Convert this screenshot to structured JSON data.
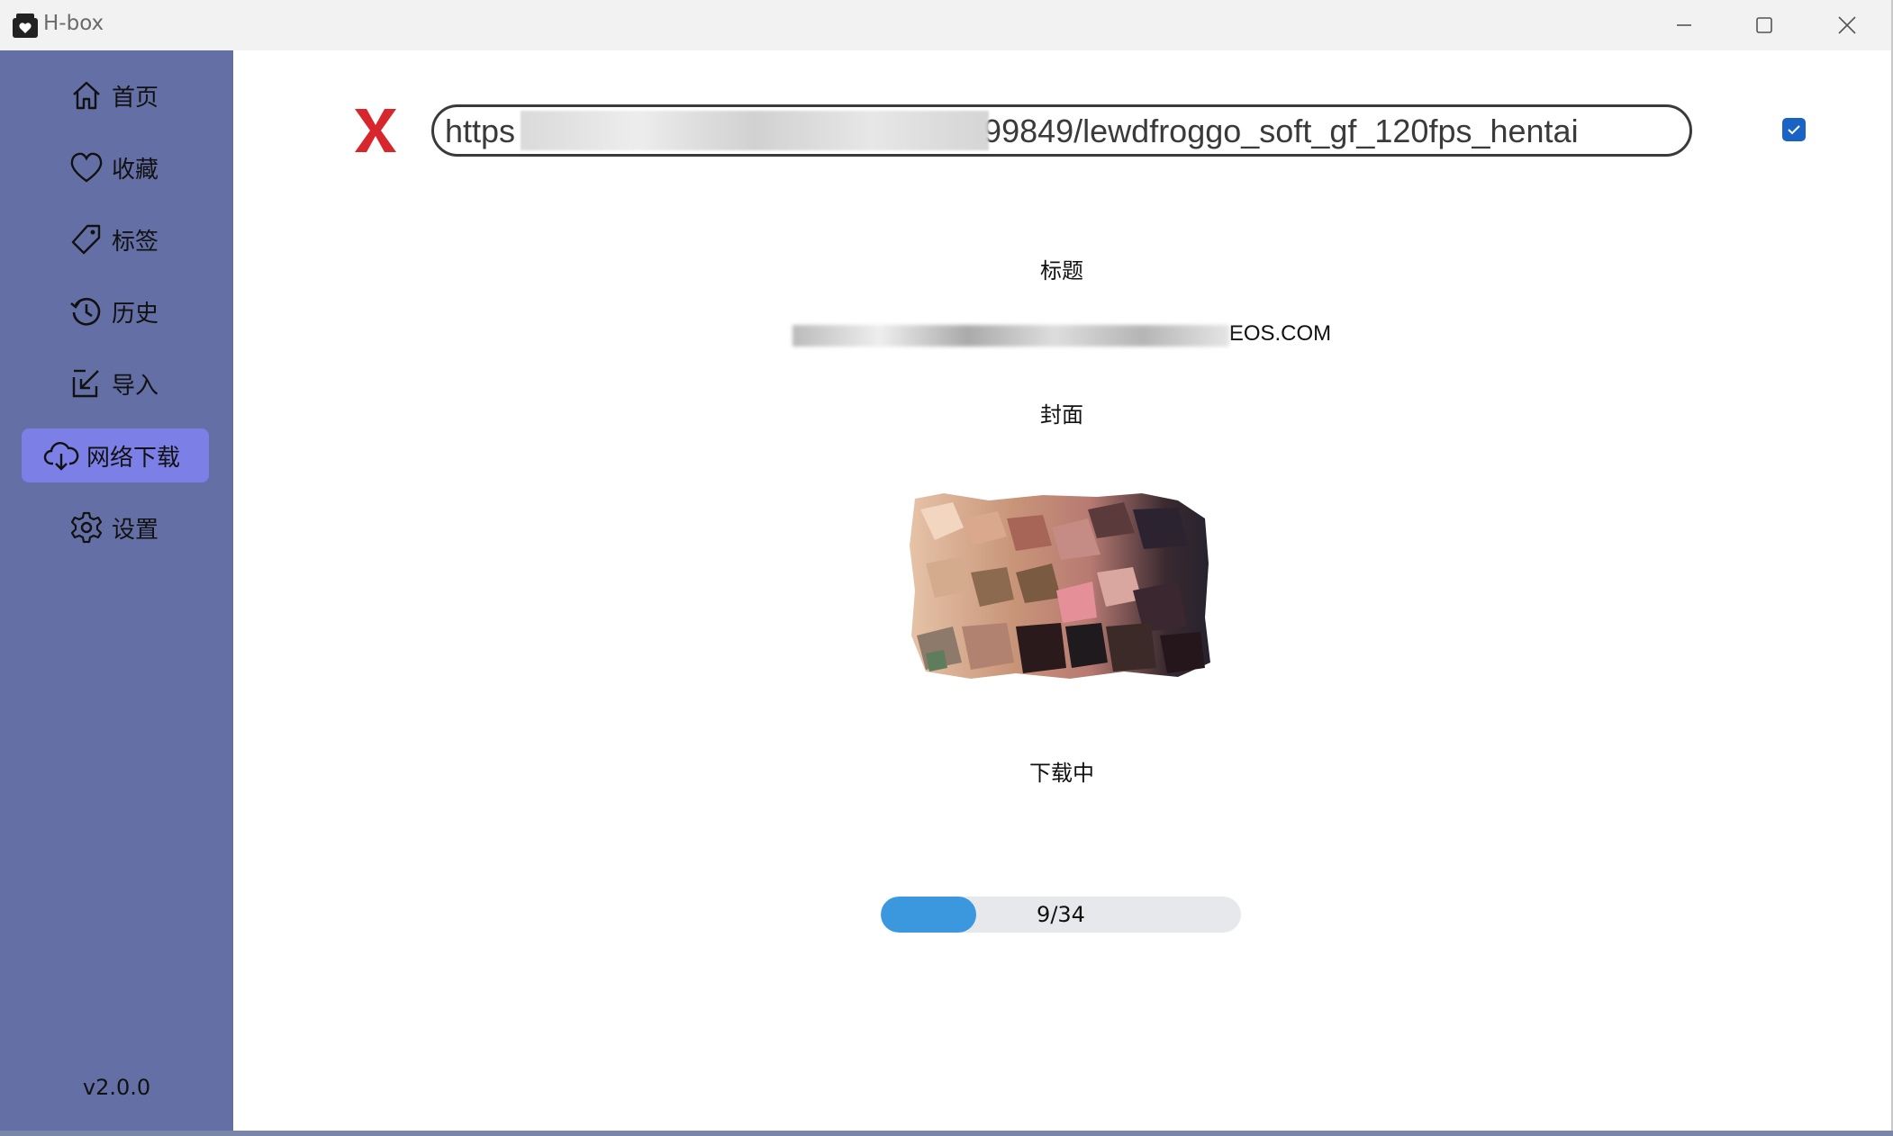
{
  "window": {
    "title": "H-box"
  },
  "sidebar": {
    "items": [
      {
        "label": "首页",
        "icon": "home-icon"
      },
      {
        "label": "收藏",
        "icon": "heart-icon"
      },
      {
        "label": "标签",
        "icon": "tag-icon"
      },
      {
        "label": "历史",
        "icon": "history-icon"
      },
      {
        "label": "导入",
        "icon": "import-icon"
      },
      {
        "label": "网络下载",
        "icon": "cloud-download-icon",
        "active": true
      },
      {
        "label": "设置",
        "icon": "gear-icon"
      }
    ],
    "version": "v2.0.0"
  },
  "download": {
    "url_prefix": "https",
    "url_suffix": "99849/lewdfroggo_soft_gf_120fps_hentai",
    "checkbox_checked": true,
    "title_label": "标题",
    "title_value_suffix": "EOS.COM",
    "cover_label": "封面",
    "status": "下载中",
    "progress": {
      "current": 9,
      "total": 34,
      "text": "9/34"
    }
  },
  "colors": {
    "sidebar": "#6470a5",
    "active_item": "#7b7fe6",
    "progress_fill": "#3b97de",
    "checkbox": "#1a62c4",
    "logo_red": "#d8262d"
  }
}
